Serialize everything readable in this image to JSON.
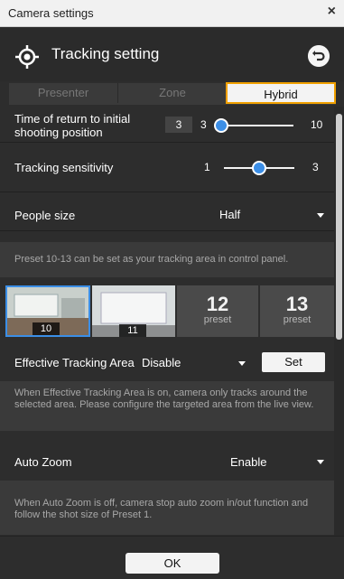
{
  "window": {
    "title": "Camera settings",
    "close_label": "×"
  },
  "header": {
    "title": "Tracking setting"
  },
  "tabs": [
    {
      "label": "Presenter",
      "selected": false
    },
    {
      "label": "Zone",
      "selected": false
    },
    {
      "label": "Hybrid",
      "selected": true
    }
  ],
  "settings": {
    "return_time": {
      "label_line1": "Time of return to initial",
      "label_line2": "shooting position",
      "value": "3",
      "min": "3",
      "max": "10",
      "level": 0
    },
    "sensitivity": {
      "label": "Tracking sensitivity",
      "min": "1",
      "max": "3",
      "level": 0.5
    },
    "people_size": {
      "label": "People size",
      "value": "Half"
    },
    "preset_note": "Preset 10-13 can be set as your tracking area in control panel.",
    "presets": [
      {
        "number": "10",
        "type": "thumbnail",
        "selected": true
      },
      {
        "number": "11",
        "type": "thumbnail",
        "selected": false
      },
      {
        "number": "12",
        "caption": "preset",
        "type": "empty"
      },
      {
        "number": "13",
        "caption": "preset",
        "type": "empty"
      }
    ],
    "effective_area": {
      "label": "Effective Tracking Area",
      "value": "Disable",
      "set_label": "Set"
    },
    "effective_note": "When Effective Tracking Area is on, camera only tracks around the selected area. Please configure the targeted area from the live view.",
    "auto_zoom": {
      "label": "Auto Zoom",
      "value": "Enable"
    },
    "auto_zoom_note": "When Auto Zoom is off, camera stop auto zoom in/out function and follow the shot size of Preset 1."
  },
  "footer": {
    "ok_label": "OK"
  },
  "colors": {
    "accent": "#3b8ee6",
    "highlight": "#f0a000",
    "panel": "#2d2d2d"
  },
  "icons": {
    "header": "target-icon",
    "back": "undo-icon"
  }
}
